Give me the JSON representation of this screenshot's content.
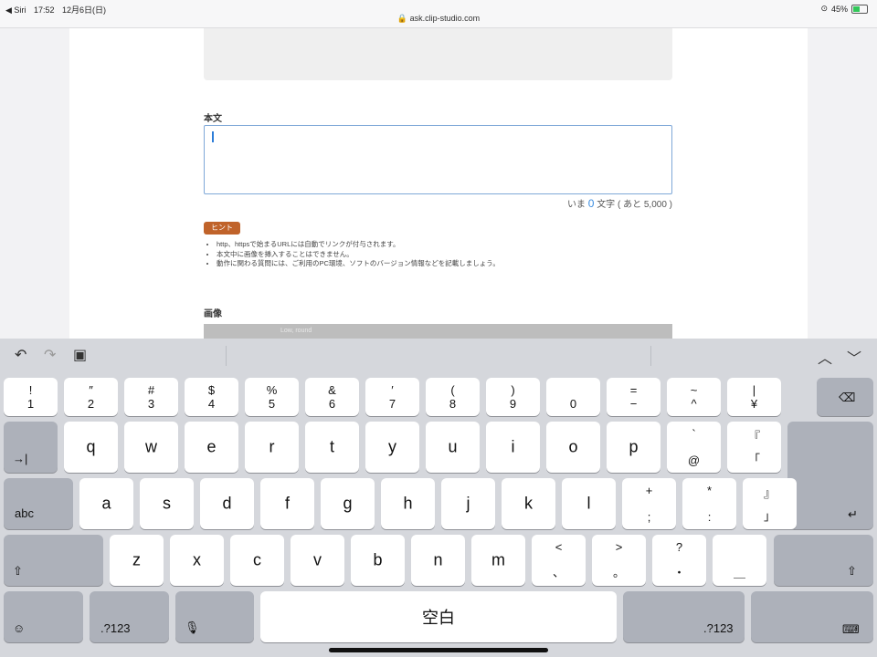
{
  "status_bar": {
    "back_app": "◀ Siri",
    "time": "17:52",
    "date": "12月6日(日)",
    "url": "ask.clip-studio.com",
    "battery": "45%",
    "battery_level": 0.45
  },
  "form": {
    "body_label": "本文",
    "counter": {
      "prefix": "いま",
      "count": "0",
      "suffix": "文字 ( あと 5,000 )"
    },
    "hint_badge": "ヒント",
    "hints": [
      "http、httpsで始まるURLには自動でリンクが付与されます。",
      "本文中に画像を挿入することはできません。",
      "動作に関わる質問には、ご利用のPC環境、ソフトのバージョン情報などを記載しましょう。"
    ],
    "image_label": "画像",
    "image_bar_text": "Low, round"
  },
  "toolbar": {
    "undo_icon": "undo-icon",
    "redo_icon": "redo-icon",
    "paste_icon": "paste-icon",
    "up_icon": "chevron-up-icon",
    "down_icon": "chevron-down-icon"
  },
  "keyboard": {
    "row1": [
      {
        "top": "!",
        "bot": "1"
      },
      {
        "top": "″",
        "bot": "2"
      },
      {
        "top": "#",
        "bot": "3"
      },
      {
        "top": "$",
        "bot": "4"
      },
      {
        "top": "%",
        "bot": "5"
      },
      {
        "top": "&",
        "bot": "6"
      },
      {
        "top": "′",
        "bot": "7"
      },
      {
        "top": "(",
        "bot": "8"
      },
      {
        "top": ")",
        "bot": "9"
      },
      {
        "top": "",
        "bot": "0"
      },
      {
        "top": "=",
        "bot": "−"
      },
      {
        "top": "~",
        "bot": "^"
      },
      {
        "top": "|",
        "bot": "¥"
      }
    ],
    "row2": [
      "q",
      "w",
      "e",
      "r",
      "t",
      "y",
      "u",
      "i",
      "o",
      "p"
    ],
    "row2_extra": [
      {
        "top": "`",
        "bot": "@"
      },
      {
        "top": "『",
        "bot": "「"
      }
    ],
    "row3": [
      "a",
      "s",
      "d",
      "f",
      "g",
      "h",
      "j",
      "k",
      "l"
    ],
    "row3_extra": [
      {
        "top": "+",
        "bot": ";"
      },
      {
        "top": "*",
        "bot": ":"
      },
      {
        "top": "』",
        "bot": "」"
      }
    ],
    "row4": [
      "z",
      "x",
      "c",
      "v",
      "b",
      "n",
      "m"
    ],
    "row4_extra": [
      {
        "top": "<",
        "bot": "、"
      },
      {
        "top": ">",
        "bot": "。"
      },
      {
        "top": "?",
        "bot": "・"
      },
      {
        "top": "",
        "bot": "＿"
      }
    ],
    "tab_label": "→|",
    "abc_label": "abc",
    "num_label": ".?123",
    "space_label": "空白"
  }
}
